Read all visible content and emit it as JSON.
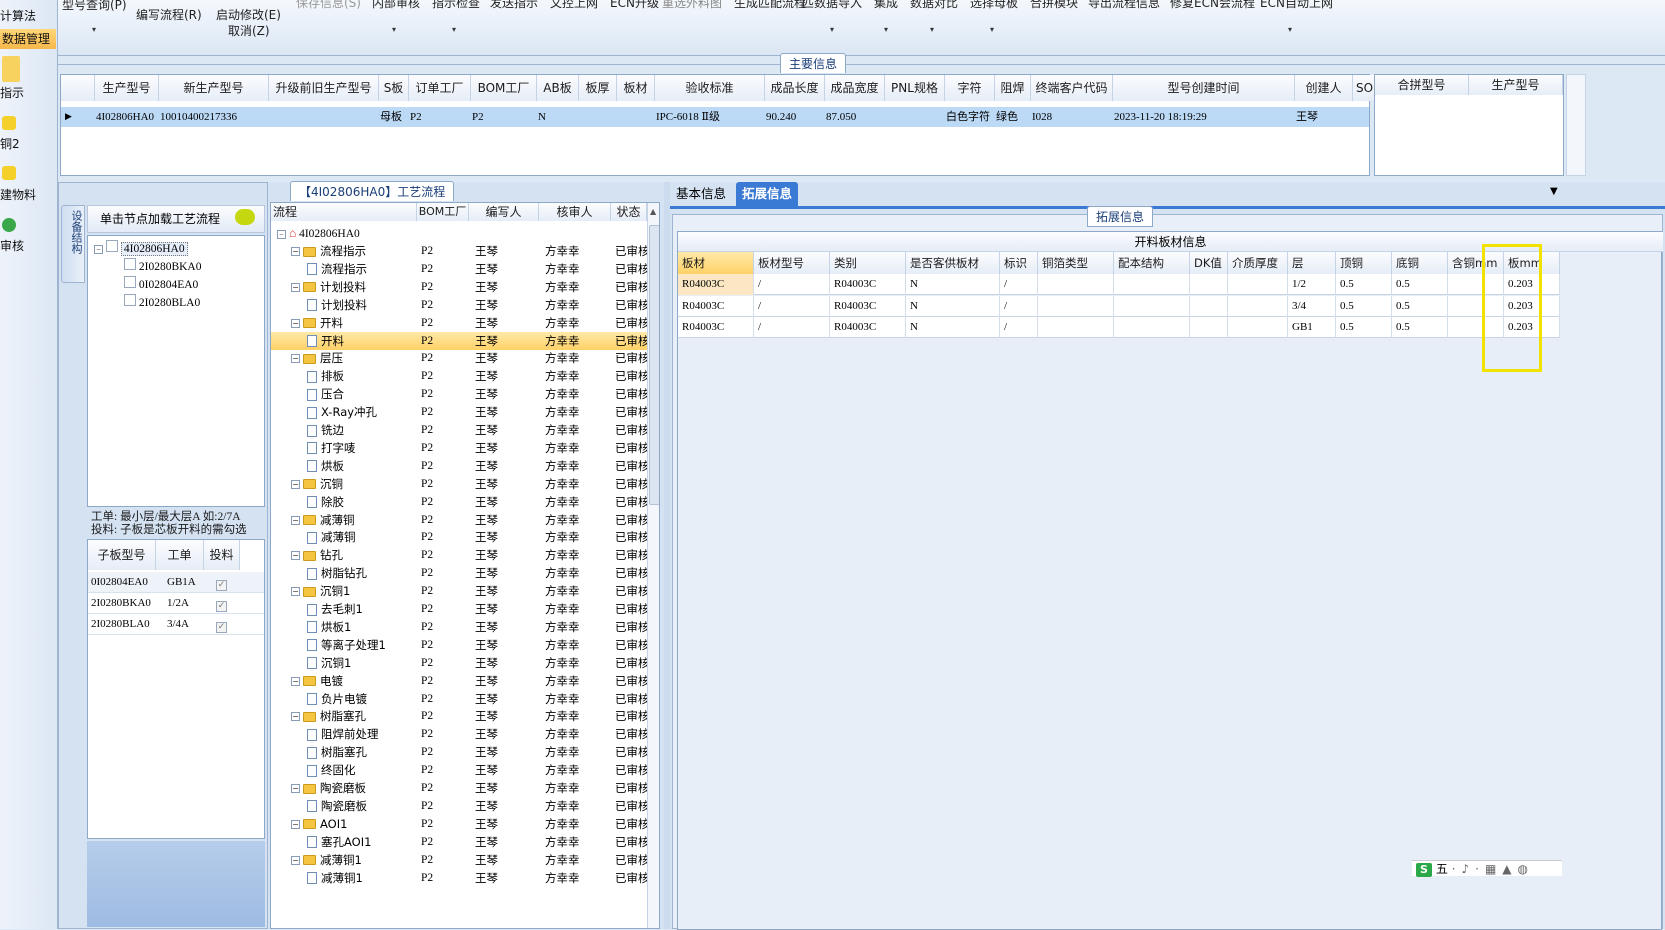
{
  "ribbon": {
    "items": [
      "型号查询(P)",
      "编写流程(R)",
      "启动修改(E)",
      "取消(Z)",
      "保存信息(S)",
      "内部审核",
      "指示检查",
      "发送指示",
      "文控上网",
      "ECN升级",
      "重选外料图",
      "生成匹配流程",
      "匹数据导入",
      "集成",
      "数据对比",
      "选择母板",
      "合拼模块",
      "导出流程信息",
      "修复ECN会流程",
      "ECN自动上网"
    ]
  },
  "leftnav": {
    "items": [
      "计算法",
      "数据管理",
      "指示",
      "铜2",
      "建物料",
      "审核"
    ]
  },
  "main_info": {
    "caption": "主要信息",
    "columns": [
      "生产型号",
      "新生产型号",
      "升级前旧生产型号",
      "S板",
      "订单工厂",
      "BOM工厂",
      "AB板",
      "板厚",
      "板材",
      "验收标准",
      "成品长度",
      "成品宽度",
      "PNL规格",
      "字符",
      "阻焊",
      "终端客户代码",
      "型号创建时间",
      "创建人",
      "SO"
    ],
    "row": [
      "4I02806HA0",
      "10010400217336",
      "",
      "母板",
      "P2",
      "P2",
      "N",
      "",
      "",
      "IPC-6018 Ⅱ级",
      "90.240",
      "87.050",
      "",
      "白色字符",
      "绿色",
      "I028",
      "2023-11-20 18:19:29",
      "王琴",
      ""
    ],
    "right_columns": [
      "合拼型号",
      "生产型号"
    ]
  },
  "struct_panel": {
    "side_tab": "设备结构",
    "load_hint": "单击节点加载工艺流程",
    "tree": [
      "4I02806HA0",
      "2I0280BKA0",
      "0I02804EA0",
      "2I0280BLA0"
    ],
    "note1": "工单: 最小层/最大层A 如:2/7A",
    "note2": "投料: 子板是芯板开料的需勾选",
    "sub_columns": [
      "子板型号",
      "工单",
      "投料"
    ],
    "sub_rows": [
      {
        "model": "0I02804EA0",
        "order": "GB1A"
      },
      {
        "model": "2I0280BKA0",
        "order": "1/2A"
      },
      {
        "model": "2I0280BLA0",
        "order": "3/4A"
      }
    ]
  },
  "flow_panel": {
    "caption": "【4I02806HA0】工艺流程",
    "columns": [
      "流程",
      "BOM工厂",
      "编写人",
      "核审人",
      "状态"
    ],
    "root": "4I02806HA0",
    "rows": [
      {
        "level": 1,
        "name": "流程指示"
      },
      {
        "level": 2,
        "name": "流程指示"
      },
      {
        "level": 1,
        "name": "计划投料"
      },
      {
        "level": 2,
        "name": "计划投料"
      },
      {
        "level": 1,
        "name": "开料"
      },
      {
        "level": 2,
        "name": "开料",
        "selected": true
      },
      {
        "level": 1,
        "name": "层压"
      },
      {
        "level": 2,
        "name": "排板"
      },
      {
        "level": 2,
        "name": "压合"
      },
      {
        "level": 2,
        "name": "X-Ray冲孔"
      },
      {
        "level": 2,
        "name": "铣边"
      },
      {
        "level": 2,
        "name": "打字唛"
      },
      {
        "level": 2,
        "name": "烘板"
      },
      {
        "level": 1,
        "name": "沉铜"
      },
      {
        "level": 2,
        "name": "除胶"
      },
      {
        "level": 1,
        "name": "减薄铜"
      },
      {
        "level": 2,
        "name": "减薄铜"
      },
      {
        "level": 1,
        "name": "钻孔"
      },
      {
        "level": 2,
        "name": "树脂钻孔"
      },
      {
        "level": 1,
        "name": "沉铜1"
      },
      {
        "level": 2,
        "name": "去毛刺1"
      },
      {
        "level": 2,
        "name": "烘板1"
      },
      {
        "level": 2,
        "name": "等离子处理1"
      },
      {
        "level": 2,
        "name": "沉铜1"
      },
      {
        "level": 1,
        "name": "电镀"
      },
      {
        "level": 2,
        "name": "负片电镀"
      },
      {
        "level": 1,
        "name": "树脂塞孔"
      },
      {
        "level": 2,
        "name": "阻焊前处理"
      },
      {
        "level": 2,
        "name": "树脂塞孔"
      },
      {
        "level": 2,
        "name": "终固化"
      },
      {
        "level": 1,
        "name": "陶瓷磨板"
      },
      {
        "level": 2,
        "name": "陶瓷磨板"
      },
      {
        "level": 1,
        "name": "AOI1"
      },
      {
        "level": 2,
        "name": "塞孔AOI1"
      },
      {
        "level": 1,
        "name": "减薄铜1"
      },
      {
        "level": 2,
        "name": "减薄铜1"
      }
    ],
    "bom": "P2",
    "writer": "王琴",
    "reviewer": "方幸幸",
    "status": "已审核"
  },
  "detail_panel": {
    "tabs": [
      "基本信息",
      "拓展信息"
    ],
    "active_tab": "拓展信息",
    "caption": "拓展信息",
    "table_title": "开料板材信息",
    "columns": [
      "板材",
      "板材型号",
      "类别",
      "是否客供板材",
      "标识",
      "铜箔类型",
      "配本结构",
      "DK值",
      "介质厚度",
      "层",
      "顶铜",
      "底铜",
      "含铜mm",
      "板mm"
    ],
    "rows": [
      [
        "R04003C",
        "/",
        "R04003C",
        "N",
        "/",
        "",
        "",
        "",
        "",
        "1/2",
        "0.5",
        "0.5",
        "",
        "0.203"
      ],
      [
        "R04003C",
        "/",
        "R04003C",
        "N",
        "/",
        "",
        "",
        "",
        "",
        "3/4",
        "0.5",
        "0.5",
        "",
        "0.203"
      ],
      [
        "R04003C",
        "/",
        "R04003C",
        "N",
        "/",
        "",
        "",
        "",
        "",
        "GB1",
        "0.5",
        "0.5",
        "",
        "0.203"
      ]
    ]
  },
  "taskbar": {
    "ime": "五"
  },
  "colors": {
    "highlight": "#f2e200",
    "selected_row": "#bcd9f6",
    "selected_node": "#ffd77a",
    "accent": "#3a7ad4"
  }
}
